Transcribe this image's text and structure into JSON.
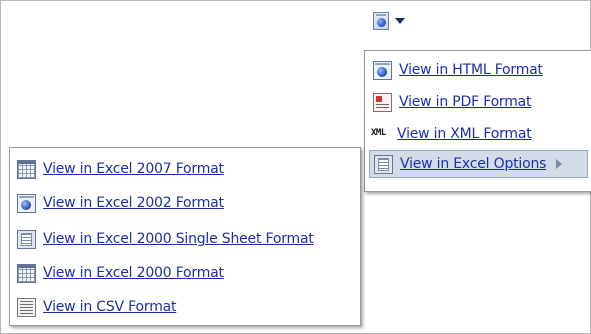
{
  "toolbar": {
    "export_icon": "html-export-icon",
    "dropdown_icon": "caret-down-icon"
  },
  "export_menu": {
    "items": [
      {
        "label": "View in HTML Format",
        "icon": "html-globe-icon"
      },
      {
        "label": "View in PDF Format",
        "icon": "pdf-document-icon"
      },
      {
        "label": "View in XML Format",
        "icon": "xml-icon",
        "icon_text": "XML"
      },
      {
        "label": "View in Excel Options",
        "icon": "excel-options-icon",
        "has_submenu": true,
        "active": true
      }
    ]
  },
  "excel_submenu": {
    "items": [
      {
        "label": "View in Excel 2007 Format",
        "icon": "excel-2007-icon"
      },
      {
        "label": "View in Excel 2002 Format",
        "icon": "excel-2002-icon"
      },
      {
        "label": "View in Excel 2000 Single Sheet Format",
        "icon": "excel-single-sheet-icon"
      },
      {
        "label": "View in Excel 2000 Format",
        "icon": "excel-2000-icon"
      },
      {
        "label": "View in CSV Format",
        "icon": "csv-icon"
      }
    ]
  }
}
